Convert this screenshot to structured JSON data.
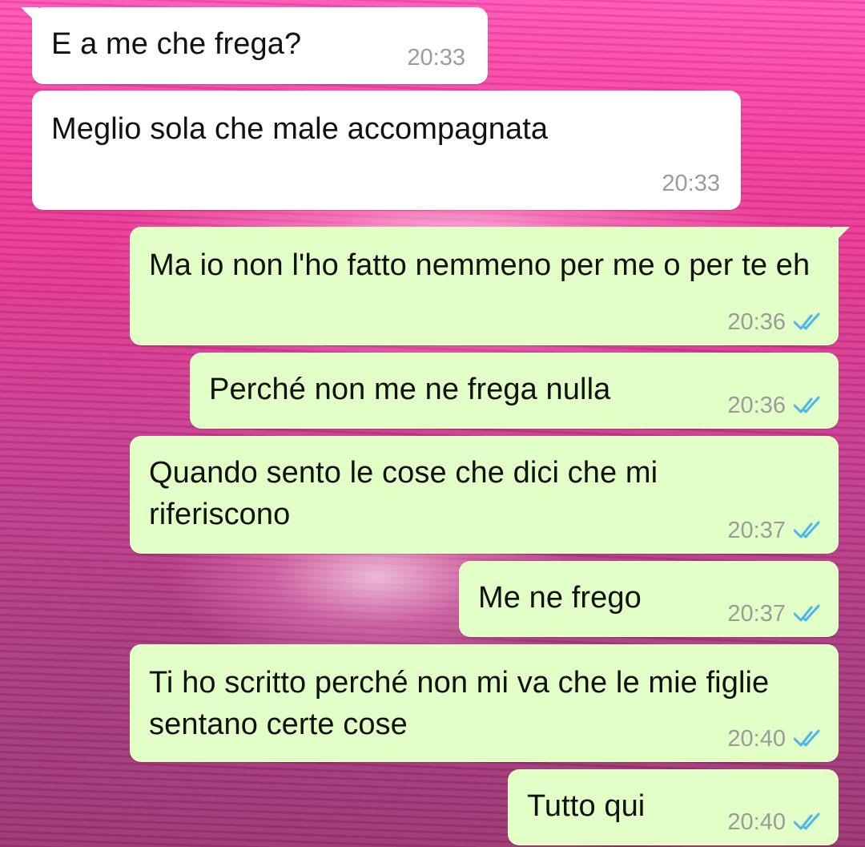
{
  "messages": [
    {
      "text": "E a me che frega?",
      "time": "20:33",
      "direction": "incoming"
    },
    {
      "text": "Meglio sola che male accompagnata",
      "time": "20:33",
      "direction": "incoming"
    },
    {
      "text": "Ma io non l'ho fatto nemmeno per me o per te eh",
      "time": "20:36",
      "direction": "outgoing",
      "status": "read"
    },
    {
      "text": "Perché non me ne frega nulla",
      "time": "20:36",
      "direction": "outgoing",
      "status": "read"
    },
    {
      "text": "Quando sento le cose che dici che mi riferiscono",
      "time": "20:37",
      "direction": "outgoing",
      "status": "read"
    },
    {
      "text": "Me ne frego",
      "time": "20:37",
      "direction": "outgoing",
      "status": "read"
    },
    {
      "text": "Ti ho scritto perché non mi va che le mie figlie sentano certe cose",
      "time": "20:40",
      "direction": "outgoing",
      "status": "read"
    },
    {
      "text": "Tutto qui",
      "time": "20:40",
      "direction": "outgoing",
      "status": "read"
    }
  ],
  "colors": {
    "incoming_bubble": "#ffffff",
    "outgoing_bubble": "#e1ffc7",
    "read_tick": "#4fb6ec",
    "timestamp": "#9b9b9b"
  },
  "icons": {
    "read_receipt": "double-check-icon"
  }
}
